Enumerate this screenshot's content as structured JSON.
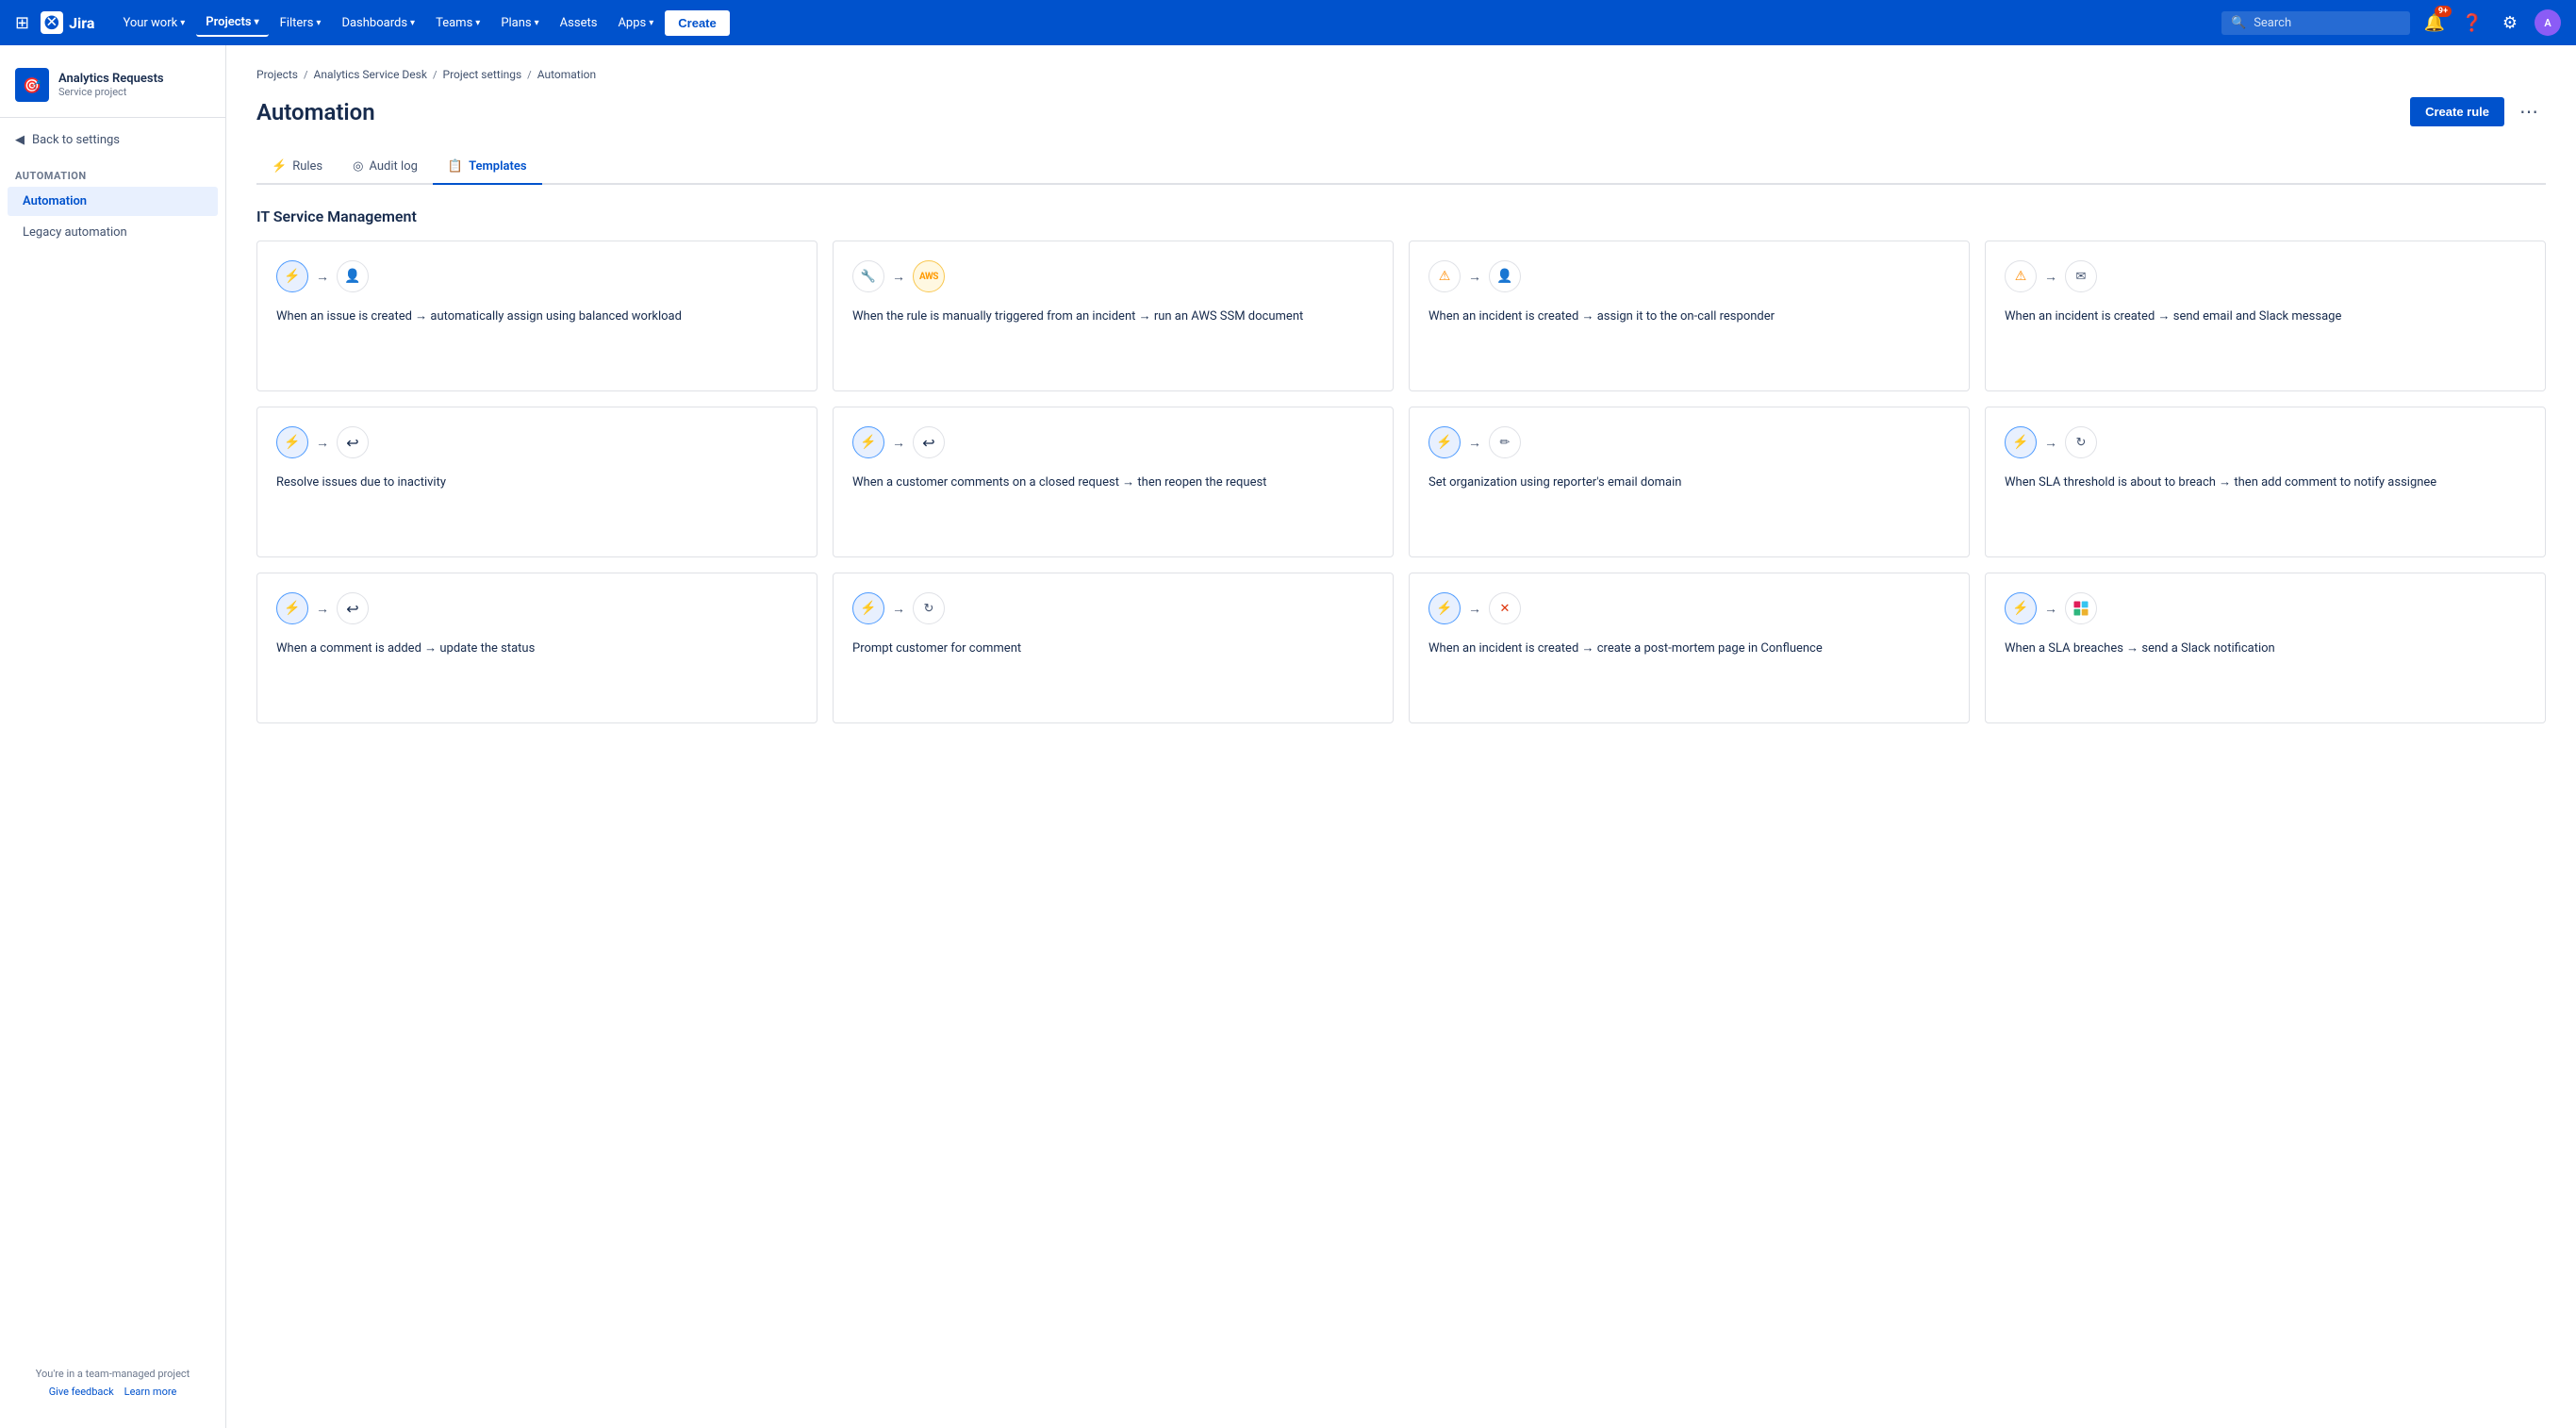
{
  "topnav": {
    "logo_text": "Jira",
    "nav_items": [
      {
        "label": "Your work",
        "has_dropdown": true,
        "active": false
      },
      {
        "label": "Projects",
        "has_dropdown": true,
        "active": true
      },
      {
        "label": "Filters",
        "has_dropdown": true,
        "active": false
      },
      {
        "label": "Dashboards",
        "has_dropdown": true,
        "active": false
      },
      {
        "label": "Teams",
        "has_dropdown": true,
        "active": false
      },
      {
        "label": "Plans",
        "has_dropdown": true,
        "active": false
      },
      {
        "label": "Assets",
        "has_dropdown": false,
        "active": false
      },
      {
        "label": "Apps",
        "has_dropdown": true,
        "active": false
      }
    ],
    "create_label": "Create",
    "search_placeholder": "Search",
    "notification_count": "9+",
    "avatar_initials": "A"
  },
  "sidebar": {
    "project_name": "Analytics Requests",
    "project_type": "Service project",
    "back_label": "Back to settings",
    "section_label": "AUTOMATION",
    "items": [
      {
        "label": "Automation",
        "active": true
      },
      {
        "label": "Legacy automation",
        "active": false
      }
    ],
    "footer_note": "You're in a team-managed project",
    "feedback_label": "Give feedback",
    "learn_label": "Learn more"
  },
  "breadcrumb": {
    "items": [
      "Projects",
      "Analytics Service Desk",
      "Project settings",
      "Automation"
    ]
  },
  "page": {
    "title": "Automation",
    "create_rule_label": "Create rule",
    "more_options_label": "⋯"
  },
  "tabs": [
    {
      "label": "Rules",
      "icon": "⚡",
      "active": false
    },
    {
      "label": "Audit log",
      "icon": "◎",
      "active": false
    },
    {
      "label": "Templates",
      "icon": "📋",
      "active": true
    }
  ],
  "section": {
    "title": "IT Service Management"
  },
  "cards": [
    {
      "icon1": "⚡",
      "icon1_type": "lightning",
      "icon2": "👤",
      "icon2_type": "user",
      "text": "When an issue is created → automatically assign using balanced workload"
    },
    {
      "icon1": "🔧",
      "icon1_type": "tool",
      "icon2": "AWS",
      "icon2_type": "aws",
      "text": "When the rule is manually triggered from an incident → run an AWS SSM document"
    },
    {
      "icon1": "⚠",
      "icon1_type": "warning",
      "icon2": "👤",
      "icon2_type": "user",
      "text": "When an incident is created → assign it to the on-call responder"
    },
    {
      "icon1": "⚠",
      "icon1_type": "warning",
      "icon2": "✉",
      "icon2_type": "mail",
      "text": "When an incident is created → send email and Slack message"
    },
    {
      "icon1": "⚡",
      "icon1_type": "lightning",
      "icon2": "↩",
      "icon2_type": "arrow-left",
      "text": "Resolve issues due to inactivity"
    },
    {
      "icon1": "⚡",
      "icon1_type": "lightning",
      "icon2": "↩",
      "icon2_type": "arrow-left",
      "text": "When a customer comments on a closed request → then reopen the request"
    },
    {
      "icon1": "⚡",
      "icon1_type": "lightning",
      "icon2": "✏",
      "icon2_type": "edit",
      "text": "Set organization using reporter's email domain"
    },
    {
      "icon1": "⚡",
      "icon1_type": "lightning",
      "icon2": "↻",
      "icon2_type": "refresh",
      "text": "When SLA threshold is about to breach → then add comment to notify assignee"
    },
    {
      "icon1": "⚡",
      "icon1_type": "lightning",
      "icon2": "↩",
      "icon2_type": "arrow-left",
      "text": "When a comment is added → update the status"
    },
    {
      "icon1": "⚡",
      "icon1_type": "lightning",
      "icon2": "↻",
      "icon2_type": "refresh",
      "text": "Prompt customer for comment"
    },
    {
      "icon1": "⚡",
      "icon1_type": "lightning",
      "icon2": "✕",
      "icon2_type": "cross",
      "text": "When an incident is created → create a post-mortem page in Confluence"
    },
    {
      "icon1": "⚡",
      "icon1_type": "lightning",
      "icon2": "#",
      "icon2_type": "slack",
      "text": "When a SLA breaches → send a Slack notification"
    }
  ]
}
